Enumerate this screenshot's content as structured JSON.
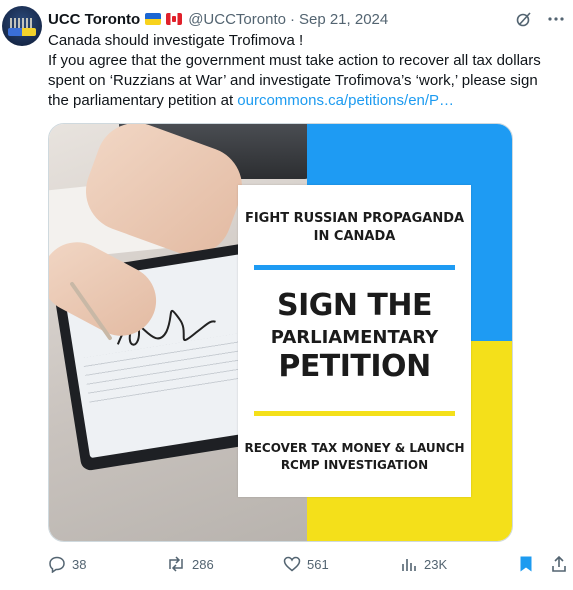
{
  "tweet": {
    "author_name": "UCC Toronto",
    "handle": "@UCCToronto",
    "separator": "·",
    "date": "Sep 21, 2024",
    "line1": "Canada should investigate Trofimova !",
    "line2_prefix": "If you agree that the government must take action to recover all tax dollars spent on ‘Ruzzians at War’ and investigate Trofimova’s ‘work,’ please sign the parliamentary petition at ",
    "link_text": "ourcommons.ca/petitions/en/P…"
  },
  "flags": [
    "ukraine-flag-icon",
    "canada-flag-icon"
  ],
  "media": {
    "card_top": "FIGHT RUSSIAN PROPAGANDA IN CANADA",
    "card_sign": "SIGN THE",
    "card_parliamentary": "PARLIAMENTARY",
    "card_petition": "PETITION",
    "card_bottom": "RECOVER TAX MONEY & LAUNCH RCMP INVESTIGATION",
    "colors": {
      "blue": "#1e9bf3",
      "yellow": "#f4e01a"
    }
  },
  "actions": {
    "replies": "38",
    "reposts": "286",
    "likes": "561",
    "views": "23K"
  },
  "colors": {
    "link": "#1d9bf0",
    "muted": "#536471",
    "bookmark": "#1d9bf0"
  }
}
